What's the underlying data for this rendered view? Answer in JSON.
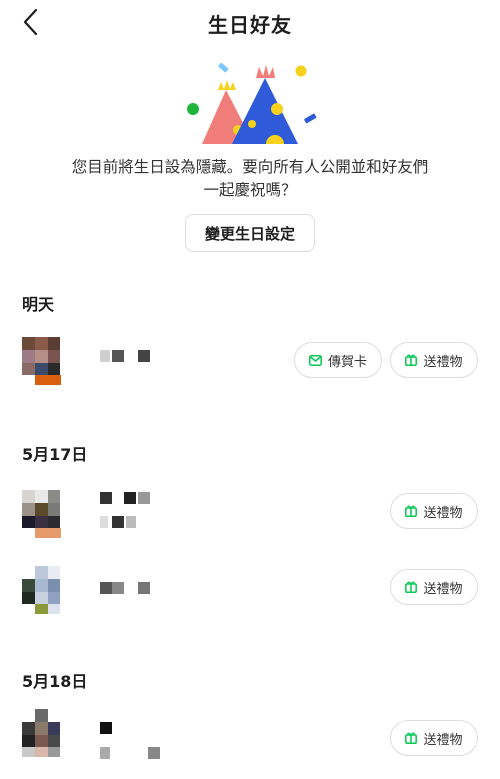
{
  "header": {
    "title": "生日好友",
    "back_icon": "chevron-left-icon"
  },
  "notice": {
    "line1": "您目前將生日設為隱藏。要向所有人公開並和好友們",
    "line2": "一起慶祝嗎？"
  },
  "change_button": "變更生日設定",
  "sections": [
    {
      "title": "明天"
    },
    {
      "title": "5月17日"
    },
    {
      "title": "5月18日"
    }
  ],
  "actions": {
    "send_card": "傳賀卡",
    "send_gift": "送禮物"
  },
  "colors": {
    "accent_green": "#06c755",
    "card_icon": "#06c755"
  }
}
